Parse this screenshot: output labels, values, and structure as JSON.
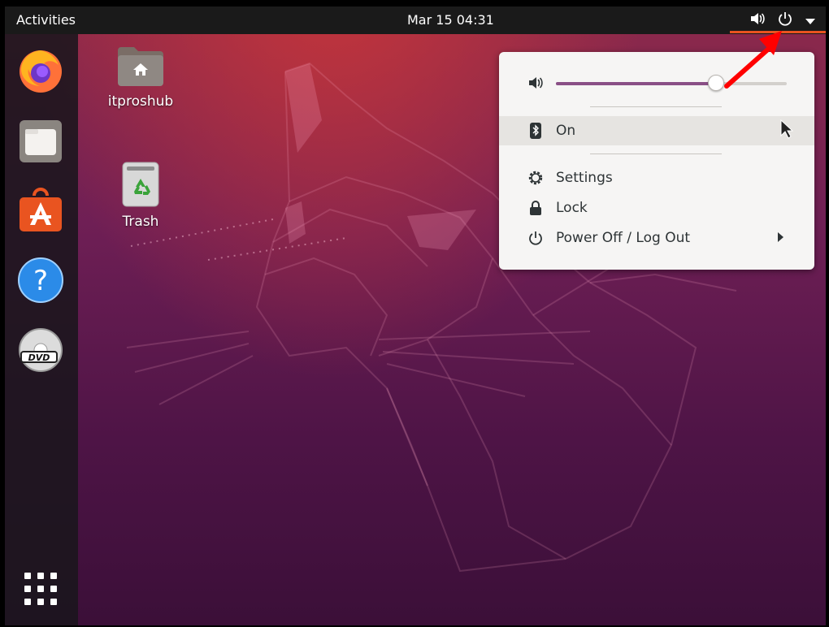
{
  "topbar": {
    "activities_label": "Activities",
    "clock": "Mar 15  04:31"
  },
  "desktop": {
    "icons": [
      {
        "label": "itproshub",
        "icon": "home-folder-icon"
      },
      {
        "label": "Trash",
        "icon": "trash-icon"
      }
    ]
  },
  "dock": {
    "items": [
      {
        "icon": "firefox-icon"
      },
      {
        "icon": "files-icon"
      },
      {
        "icon": "software-icon"
      },
      {
        "icon": "help-icon"
      },
      {
        "icon": "dvd-icon"
      },
      {
        "icon": "show-applications-icon"
      }
    ]
  },
  "system_menu": {
    "volume_level": 0.69,
    "bluetooth_label": "On",
    "settings_label": "Settings",
    "lock_label": "Lock",
    "power_label": "Power Off / Log Out"
  },
  "colors": {
    "accent": "#e95420",
    "slider_fill": "#8a4f86",
    "annotation_arrow": "#ff0000"
  }
}
